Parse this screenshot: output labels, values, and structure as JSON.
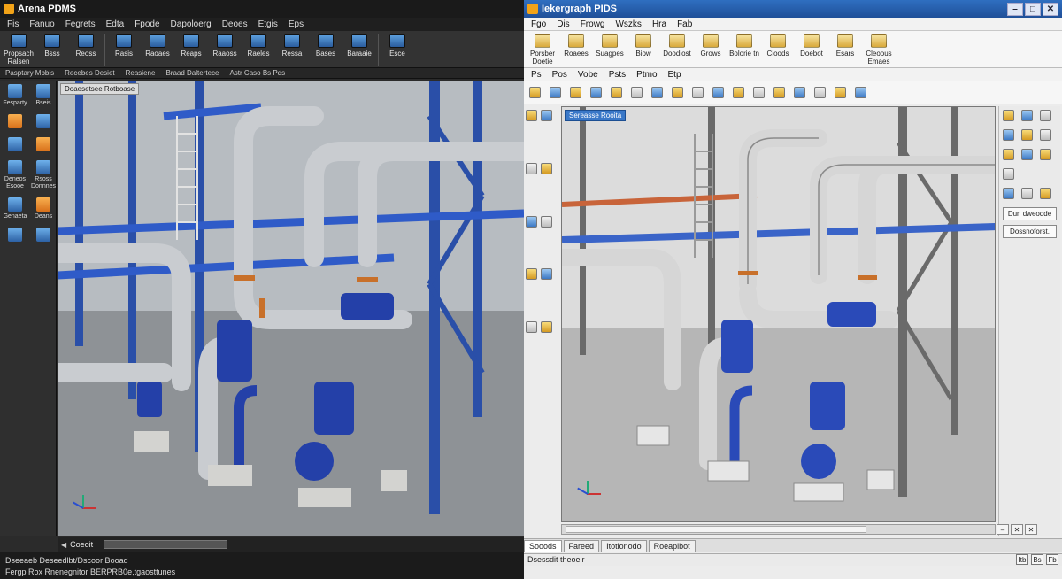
{
  "left_window": {
    "title": "Arena PDMS",
    "menu": [
      "Fis",
      "Fanuo",
      "Fegrets",
      "Edta",
      "Fpode",
      "Dapoloerg",
      "Deoes",
      "Etgis",
      "Eps"
    ],
    "ribbon": [
      {
        "label": "Propsach Ralsen"
      },
      {
        "label": "Bsss"
      },
      {
        "label": "Reoss"
      },
      {
        "label": "Rasis"
      },
      {
        "label": "Raoaes"
      },
      {
        "label": "Reaps"
      },
      {
        "label": "Raaoss"
      },
      {
        "label": "Raeles"
      },
      {
        "label": "Ressa"
      },
      {
        "label": "Bases"
      },
      {
        "label": "Baraaie"
      },
      {
        "label": "Esce"
      }
    ],
    "subbar": [
      "Pasptary Mbbis",
      "Recebes Desiet",
      "Reasiene",
      "Braad Daltertece",
      "Astr Caso Bs Pds"
    ],
    "side_panel": [
      {
        "label": "Fesparty",
        "icon": "component-icon"
      },
      {
        "label": "Bseis",
        "icon": "globe-icon"
      },
      {
        "label": "",
        "icon": "list-icon"
      },
      {
        "label": "",
        "icon": "pen-icon"
      },
      {
        "label": "",
        "icon": "search-icon"
      },
      {
        "label": "",
        "icon": "pencil-icon"
      },
      {
        "label": "Deneos Esooe",
        "icon": "pump-icon"
      },
      {
        "label": "Rsoss Donnnes",
        "icon": "network-icon"
      },
      {
        "label": "Genaeta",
        "icon": "select-icon"
      },
      {
        "label": "Deans",
        "icon": "orange-box-icon"
      },
      {
        "label": "",
        "icon": "cross-icon"
      },
      {
        "label": "",
        "icon": "pipe-icon"
      }
    ],
    "viewport_label": "Doaesetsee Rotboase",
    "command_label": "Coeoit",
    "status_lines": [
      "Dseeaeb Deseedlbt/Dscoor Booad",
      "Fergp Rox    Rnenegnitor  BERPRB0e,tgaosttunes"
    ]
  },
  "right_window": {
    "title": "Iekergraph PIDS",
    "window_buttons": [
      "–",
      "□",
      "✕"
    ],
    "menu": [
      "Fgo",
      "Dis",
      "Frowg",
      "Wszks",
      "Hra",
      "Fab"
    ],
    "ribbon": [
      {
        "label": "Porsber Doetie"
      },
      {
        "label": "Roaees"
      },
      {
        "label": "Suagpes"
      },
      {
        "label": "Biow"
      },
      {
        "label": "Doodiost"
      },
      {
        "label": "Grows"
      },
      {
        "label": "Bolorie tn"
      },
      {
        "label": "Cioods"
      },
      {
        "label": "Doebot"
      },
      {
        "label": "Esars"
      },
      {
        "label": "Cleoous Emaes"
      }
    ],
    "menu2": [
      "Ps",
      "Pos",
      "Vobe",
      "Psts",
      "Ptmo",
      "Etp"
    ],
    "viewport_label": "Sereasse Rooita",
    "right_boxes": [
      "Dun dweodde",
      "Dossnoforst."
    ],
    "tabs": [
      "Sooods",
      "Fareed",
      "Itotlonodo",
      "Roeaplbot"
    ],
    "status_text": "Dsessdit theoeir",
    "status_buttons": [
      "Itb",
      "Bs",
      "Fb"
    ],
    "mdi_buttons": [
      "–",
      "✕",
      "✕"
    ]
  }
}
